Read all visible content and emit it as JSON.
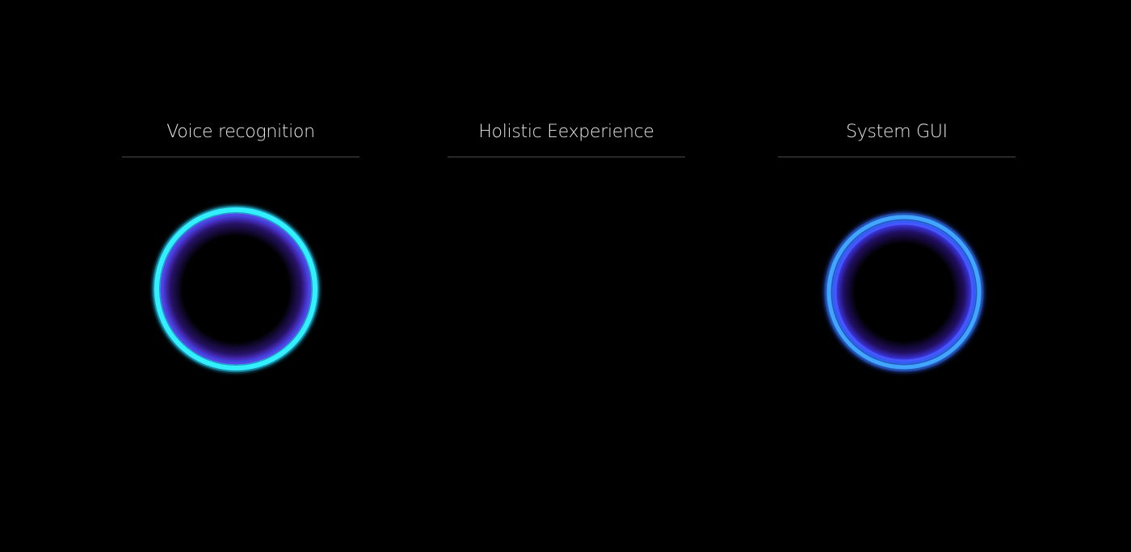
{
  "columns": [
    {
      "title": "Voice recognition"
    },
    {
      "title": "Holistic Eexperience"
    },
    {
      "title": "System GUI"
    }
  ],
  "colors": {
    "background": "#000000",
    "text": "#e8e8e8",
    "divider": "#4a4a4a",
    "ring_cyan": "#2fe6ff",
    "ring_blue": "#2f6bff",
    "ring_inner_purple": "#5a2fd6"
  },
  "icons": [
    "voice-ring-icon",
    "system-ring-icon"
  ]
}
